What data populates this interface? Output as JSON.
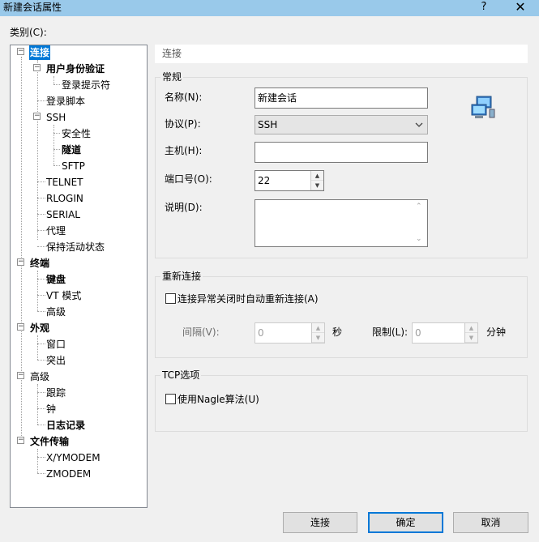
{
  "window": {
    "title": "新建会话属性",
    "help": "?",
    "close": "✕"
  },
  "category_label": "类别(C):",
  "tree": {
    "items": [
      {
        "label": "连接",
        "bold": true,
        "selected": true
      },
      {
        "label": "用户身份验证",
        "bold": true
      },
      {
        "label": "登录提示符"
      },
      {
        "label": "登录脚本"
      },
      {
        "label": "SSH"
      },
      {
        "label": "安全性"
      },
      {
        "label": "隧道",
        "bold": true
      },
      {
        "label": "SFTP"
      },
      {
        "label": "TELNET"
      },
      {
        "label": "RLOGIN"
      },
      {
        "label": "SERIAL"
      },
      {
        "label": "代理"
      },
      {
        "label": "保持活动状态"
      },
      {
        "label": "终端",
        "bold": true
      },
      {
        "label": "键盘",
        "bold": true
      },
      {
        "label": "VT 模式"
      },
      {
        "label": "高级"
      },
      {
        "label": "外观",
        "bold": true
      },
      {
        "label": "窗口"
      },
      {
        "label": "突出"
      },
      {
        "label": "高级"
      },
      {
        "label": "跟踪"
      },
      {
        "label": "钟"
      },
      {
        "label": "日志记录",
        "bold": true
      },
      {
        "label": "文件传输",
        "bold": true
      },
      {
        "label": "X/YMODEM"
      },
      {
        "label": "ZMODEM"
      }
    ]
  },
  "section_header": "连接",
  "general": {
    "title": "常规",
    "name_label": "名称(N):",
    "name_value": "新建会话",
    "protocol_label": "协议(P):",
    "protocol_value": "SSH",
    "host_label": "主机(H):",
    "host_value": "",
    "port_label": "端口号(O):",
    "port_value": "22",
    "desc_label": "说明(D):",
    "desc_value": ""
  },
  "reconnect": {
    "title": "重新连接",
    "checkbox_label": "连接异常关闭时自动重新连接(A)",
    "checked": false,
    "interval_label": "间隔(V):",
    "interval_value": "0",
    "interval_unit": "秒",
    "limit_label": "限制(L):",
    "limit_value": "0",
    "limit_unit": "分钟"
  },
  "tcp": {
    "title": "TCP选项",
    "checkbox_label": "使用Nagle算法(U)",
    "checked": false
  },
  "buttons": {
    "connect": "连接",
    "ok": "确定",
    "cancel": "取消"
  },
  "colors": {
    "titlebar": "#99c9ea",
    "selection": "#0078d7"
  }
}
